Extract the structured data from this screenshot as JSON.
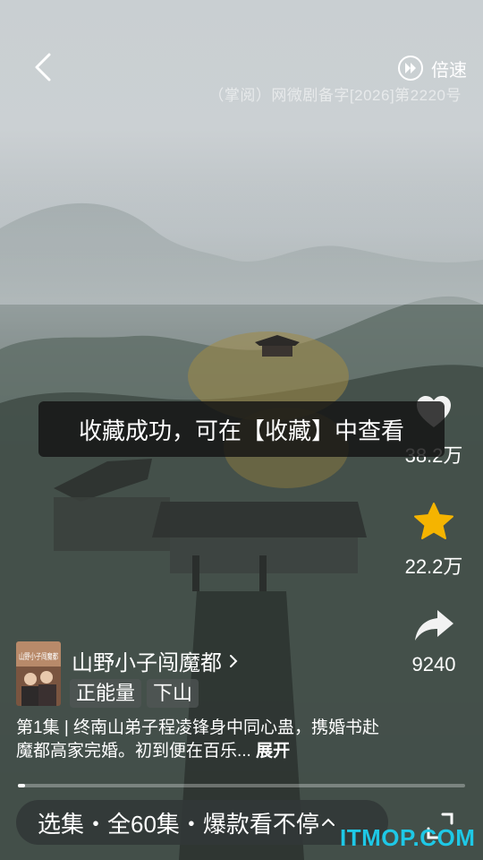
{
  "header": {
    "speed_label": "倍速",
    "license_text": "（掌阅）网微剧备字[2026]第2220号"
  },
  "toast": {
    "message": "收藏成功，可在【收藏】中查看"
  },
  "actions": {
    "like_count": "38.2万",
    "favorite_count": "22.2万",
    "share_count": "9240",
    "favorite_color": "#f5b400"
  },
  "drama": {
    "cover_text": "山野小子闯魔都",
    "title": "山野小子闯魔都",
    "tags": [
      "正能量",
      "下山"
    ],
    "description": "第1集 | 终南山弟子程凌锋身中同心蛊，携婚书赴魔都高家完婚。初到便在百乐...",
    "more_label": "展开"
  },
  "player": {
    "progress_fraction": 0.015
  },
  "episodes": {
    "label": "选集・全60集・爆款看不停"
  },
  "watermark": {
    "text": "ITMOP.COM",
    "color": "#1ec8e6"
  }
}
